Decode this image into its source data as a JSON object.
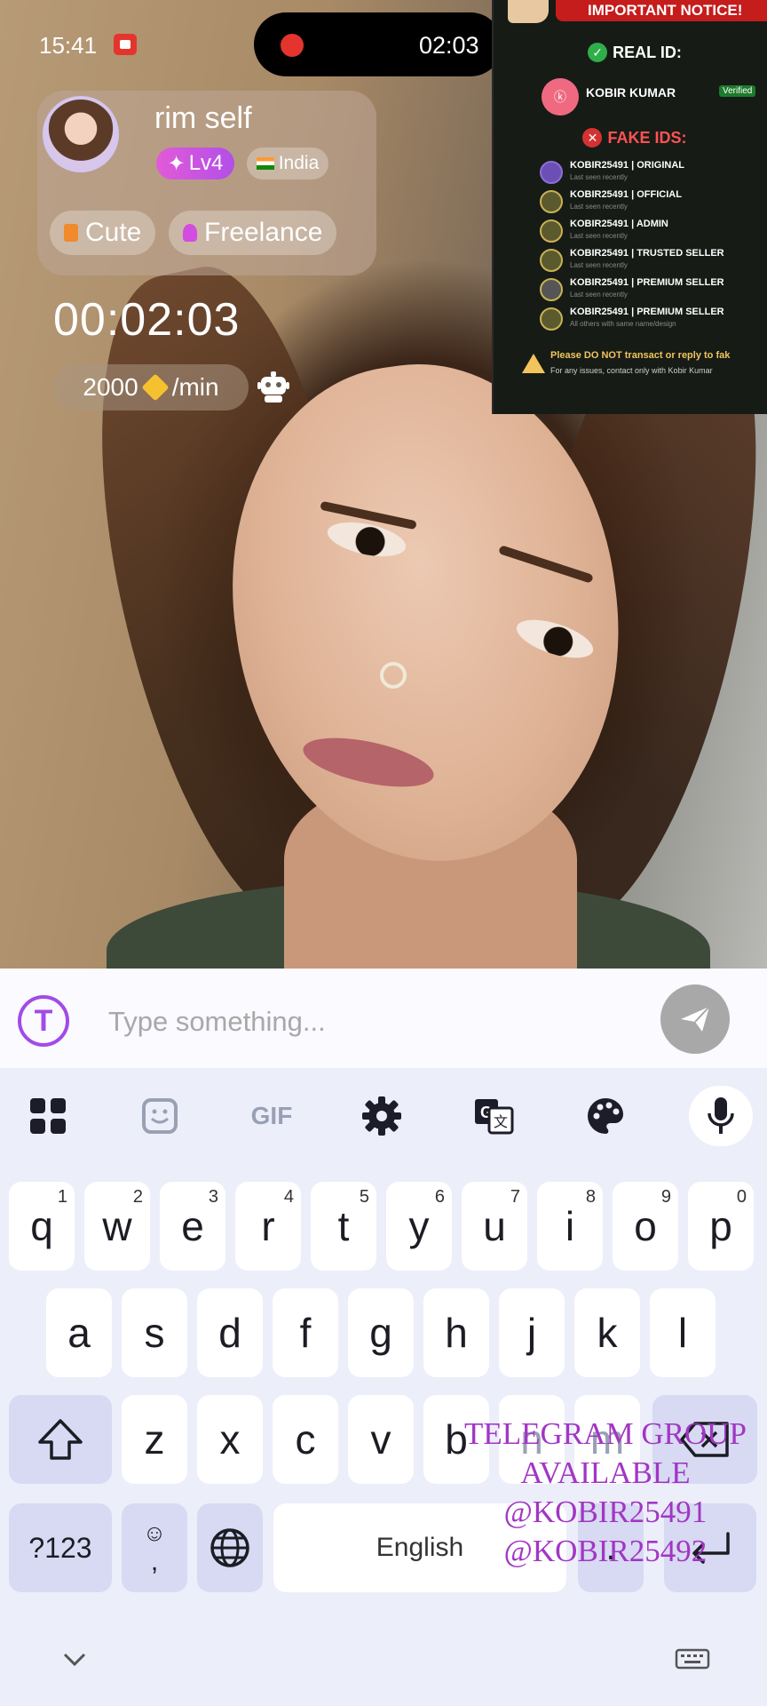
{
  "status": {
    "time": "15:41",
    "recording_time": "02:03"
  },
  "profile": {
    "username": "rim self",
    "level": "Lv4",
    "country": "India",
    "tags": [
      "Cute",
      "Freelance"
    ]
  },
  "call": {
    "timer": "00:02:03",
    "rate": "2000",
    "rate_unit": "/min"
  },
  "notice": {
    "title": "IMPORTANT NOTICE!",
    "real_heading": "REAL ID:",
    "real_name": "KOBIR KUMAR",
    "real_badge": "Verified",
    "fake_heading": "FAKE IDS:",
    "fake_ids": [
      {
        "name": "KOBIR25491 | ORIGINAL",
        "sub": "Last seen recently"
      },
      {
        "name": "KOBIR25491 | OFFICIAL",
        "sub": "Last seen recently"
      },
      {
        "name": "KOBIR25491 | ADMIN",
        "sub": "Last seen recently"
      },
      {
        "name": "KOBIR25491 | TRUSTED SELLER",
        "sub": "Last seen recently"
      },
      {
        "name": "KOBIR25491 | PREMIUM SELLER",
        "sub": "Last seen recently"
      },
      {
        "name": "KOBIR25491 | PREMIUM SELLER",
        "sub": "All others with same name/design"
      }
    ],
    "warning": "Please DO NOT transact or reply to fak",
    "warning_sub": "For any issues, contact only with Kobir Kumar"
  },
  "input": {
    "placeholder": "Type something..."
  },
  "keyboard": {
    "toolbar": [
      "apps-grid-icon",
      "sticker-icon",
      "GIF",
      "settings-gear-icon",
      "translate-icon",
      "palette-icon",
      "mic-icon"
    ],
    "gif_label": "GIF",
    "row1": [
      [
        "q",
        "1"
      ],
      [
        "w",
        "2"
      ],
      [
        "e",
        "3"
      ],
      [
        "r",
        "4"
      ],
      [
        "t",
        "5"
      ],
      [
        "y",
        "6"
      ],
      [
        "u",
        "7"
      ],
      [
        "i",
        "8"
      ],
      [
        "o",
        "9"
      ],
      [
        "p",
        "0"
      ]
    ],
    "row2": [
      "a",
      "s",
      "d",
      "f",
      "g",
      "h",
      "j",
      "k",
      "l"
    ],
    "row3": [
      "z",
      "x",
      "c",
      "v",
      "b",
      "n",
      "m"
    ],
    "symbols": "?123",
    "comma": ",",
    "space_label": "English",
    "period": "."
  },
  "watermark": [
    "TELEGRAM GROUP",
    "AVAILABLE",
    "@KOBIR25491",
    "@KOBIR25492"
  ],
  "colors": {
    "accent": "#a24be6",
    "record_red": "#e5342d",
    "keyboard_bg": "#eceefa",
    "watermark": "#a236c4"
  }
}
